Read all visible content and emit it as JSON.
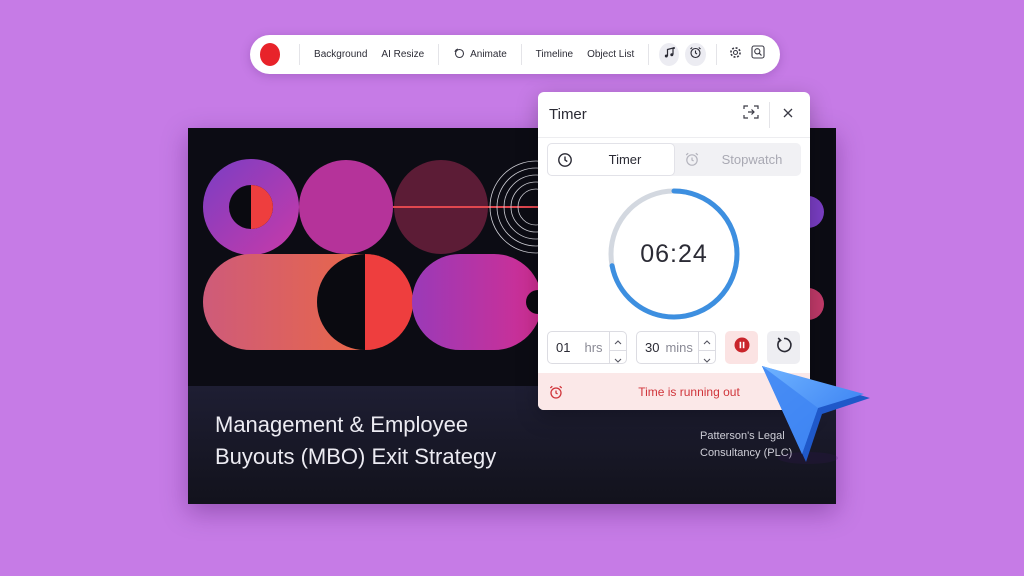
{
  "toolbar": {
    "record_color": "#e8232a",
    "background_label": "Background",
    "ai_resize_label": "AI Resize",
    "animate_label": "Animate",
    "timeline_label": "Timeline",
    "object_list_label": "Object List",
    "icons": [
      "record",
      "animate-icon",
      "music-icon",
      "alarm-clock-icon",
      "gear-icon",
      "zoom-search-icon"
    ]
  },
  "slide": {
    "title_line1": "Management & Employee",
    "title_line2": "Buyouts (MBO) Exit Strategy",
    "company_line1": "Patterson's Legal",
    "company_line2": "Consultancy (PLC)"
  },
  "timer_panel": {
    "title": "Timer",
    "tabs": [
      {
        "label": "Timer",
        "active": true,
        "icon": "clock-icon"
      },
      {
        "label": "Stopwatch",
        "active": false,
        "icon": "alarm-clock-icon"
      }
    ],
    "display_time": "06:24",
    "progress_fraction": 0.72,
    "hours_value": "01",
    "hours_unit": "hrs",
    "minutes_value": "30",
    "minutes_unit": "mins",
    "alert_text": "Time is running out",
    "accent_color": "#3d8fe0",
    "alert_color": "#d0343a"
  }
}
